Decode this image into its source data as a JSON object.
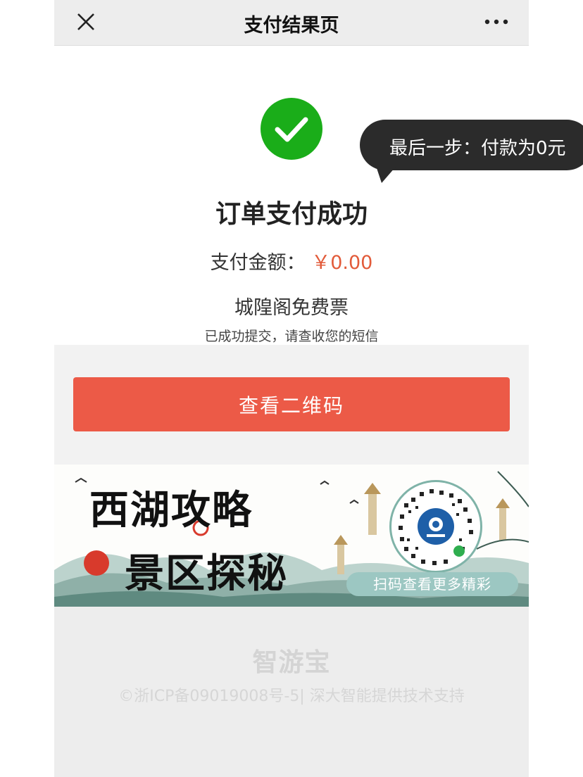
{
  "nav": {
    "title": "支付结果页",
    "close_icon": "close-icon",
    "more_icon": "more-icon"
  },
  "result": {
    "status_icon": "checkmark-circle-icon",
    "title": "订单支付成功",
    "amount_label": "支付金额：",
    "amount_value": "￥0.00",
    "ticket_name": "城隍阁免费票",
    "note": "已成功提交，请查收您的短信"
  },
  "actions": {
    "view_qr_label": "查看二维码"
  },
  "banner": {
    "title_line1": "西湖攻略",
    "title_line2": "景区探秘",
    "scan_text": "扫码查看更多精彩"
  },
  "footer": {
    "logo": "智游宝",
    "text": "©浙ICP备09019008号-5| 深大智能提供技术支持"
  },
  "annotation": {
    "text": "最后一步：付款为0元"
  },
  "colors": {
    "success_green": "#1aad19",
    "button_red": "#ec5a47",
    "amount_red": "#e25b3a",
    "tooltip_dark": "#2b2b2b"
  }
}
